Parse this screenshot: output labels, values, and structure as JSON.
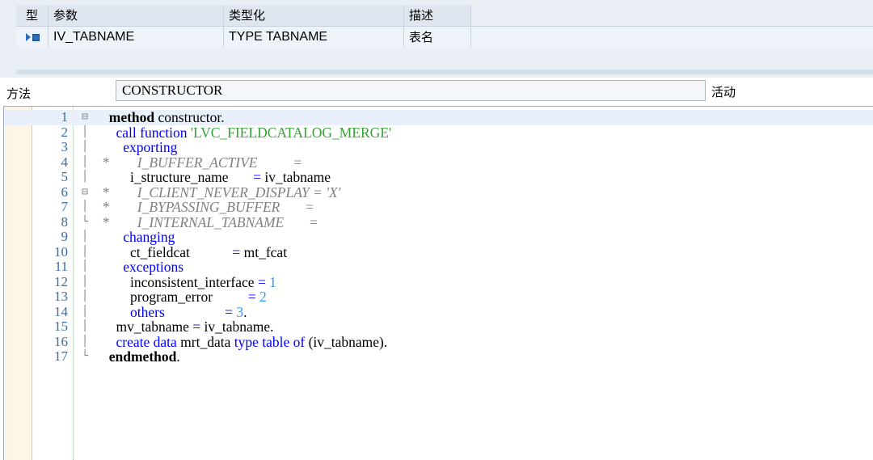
{
  "param_table": {
    "headers": {
      "type": "型",
      "param": "参数",
      "typing": "类型化",
      "desc": "描述"
    },
    "rows": [
      {
        "icon": "importing-parameter-icon",
        "param": "IV_TABNAME",
        "typing": "TYPE TABNAME",
        "desc": "表名"
      }
    ]
  },
  "method_bar": {
    "label": "方法",
    "method_name": "CONSTRUCTOR",
    "status": "活动"
  },
  "editor": {
    "lines": [
      {
        "n": "1",
        "fold": "⊟",
        "segs": [
          [
            "kwb",
            "method"
          ],
          [
            "plain",
            " constructor."
          ]
        ],
        "current": true,
        "indent": "  "
      },
      {
        "n": "2",
        "fold": "│",
        "segs": [
          [
            "kw",
            "call function"
          ],
          [
            "plain",
            " "
          ],
          [
            "str",
            "'LVC_FIELDCATALOG_MERGE'"
          ]
        ],
        "indent": "    "
      },
      {
        "n": "3",
        "fold": "│",
        "segs": [
          [
            "kw",
            "exporting"
          ]
        ],
        "indent": "      "
      },
      {
        "n": "4",
        "fold": "│",
        "segs": [
          [
            "cmt",
            "*        I_BUFFER_ACTIVE          ="
          ]
        ],
        "indent": ""
      },
      {
        "n": "5",
        "fold": "│",
        "segs": [
          [
            "plain",
            "i_structure_name       "
          ],
          [
            "op",
            "="
          ],
          [
            "plain",
            " iv_tabname"
          ]
        ],
        "indent": "        "
      },
      {
        "n": "6",
        "fold": "⊟",
        "segs": [
          [
            "cmt",
            "*        I_CLIENT_NEVER_DISPLAY = 'X'"
          ]
        ],
        "indent": ""
      },
      {
        "n": "7",
        "fold": "│",
        "segs": [
          [
            "cmt",
            "*        I_BYPASSING_BUFFER       ="
          ]
        ],
        "indent": ""
      },
      {
        "n": "8",
        "fold": "└",
        "segs": [
          [
            "cmt",
            "*        I_INTERNAL_TABNAME       ="
          ]
        ],
        "indent": ""
      },
      {
        "n": "9",
        "fold": "│",
        "segs": [
          [
            "kw",
            "changing"
          ]
        ],
        "indent": "      "
      },
      {
        "n": "10",
        "fold": "│",
        "segs": [
          [
            "plain",
            "ct_fieldcat            "
          ],
          [
            "op",
            "="
          ],
          [
            "plain",
            " mt_fcat"
          ]
        ],
        "indent": "        "
      },
      {
        "n": "11",
        "fold": "│",
        "segs": [
          [
            "kw",
            "exceptions"
          ]
        ],
        "indent": "      "
      },
      {
        "n": "12",
        "fold": "│",
        "segs": [
          [
            "plain",
            "inconsistent_interface "
          ],
          [
            "op",
            "="
          ],
          [
            "plain",
            " "
          ],
          [
            "num",
            "1"
          ]
        ],
        "indent": "        "
      },
      {
        "n": "13",
        "fold": "│",
        "segs": [
          [
            "plain",
            "program_error          "
          ],
          [
            "op",
            "="
          ],
          [
            "plain",
            " "
          ],
          [
            "num",
            "2"
          ]
        ],
        "indent": "        "
      },
      {
        "n": "14",
        "fold": "│",
        "segs": [
          [
            "kw",
            "others"
          ],
          [
            "plain",
            "                 "
          ],
          [
            "op",
            "="
          ],
          [
            "plain",
            " "
          ],
          [
            "num",
            "3"
          ],
          [
            "plain",
            "."
          ]
        ],
        "indent": "        "
      },
      {
        "n": "15",
        "fold": "│",
        "segs": [
          [
            "plain",
            "mv_tabname "
          ],
          [
            "op",
            "="
          ],
          [
            "plain",
            " iv_tabname."
          ]
        ],
        "indent": "    "
      },
      {
        "n": "16",
        "fold": "│",
        "segs": [
          [
            "kw",
            "create data"
          ],
          [
            "plain",
            " mrt_data "
          ],
          [
            "kw",
            "type table of"
          ],
          [
            "plain",
            " (iv_tabname)."
          ]
        ],
        "indent": "    "
      },
      {
        "n": "17",
        "fold": "└",
        "segs": [
          [
            "kwb",
            "endmethod"
          ],
          [
            "plain",
            "."
          ]
        ],
        "indent": "  "
      }
    ]
  },
  "colors": {
    "keyword": "#0000ff",
    "string": "#34a534",
    "number": "#3399ff",
    "comment": "#808080",
    "line_number": "#3a6ea5"
  }
}
